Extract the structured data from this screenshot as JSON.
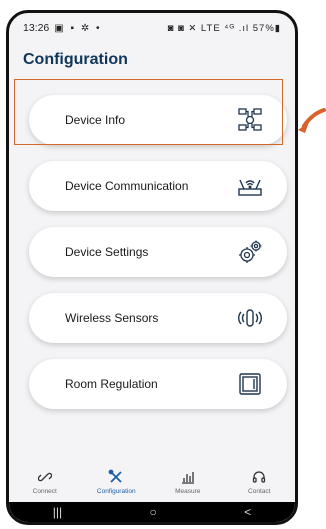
{
  "status": {
    "time": "13:26",
    "left_icons": "▣ ▪ ✲ •",
    "right_icons": "◙ ◙ ✕ LTE ⁴ᴳ .ıl 57%▮"
  },
  "header": {
    "title": "Configuration"
  },
  "cards": [
    {
      "label": "Device Info",
      "icon": "device-network-icon"
    },
    {
      "label": "Device Communication",
      "icon": "router-icon"
    },
    {
      "label": "Device Settings",
      "icon": "gears-icon"
    },
    {
      "label": "Wireless Sensors",
      "icon": "wireless-sensor-icon"
    },
    {
      "label": "Room Regulation",
      "icon": "thermostat-icon"
    }
  ],
  "nav": [
    {
      "label": "Connect",
      "icon": "link-icon"
    },
    {
      "label": "Configuration",
      "icon": "tools-icon",
      "active": true
    },
    {
      "label": "Measure",
      "icon": "bar-chart-icon"
    },
    {
      "label": "Contact",
      "icon": "headset-icon"
    }
  ],
  "system_nav": {
    "recents": "|||",
    "home": "○",
    "back": "<"
  },
  "colors": {
    "title": "#10365a",
    "accent": "#1d5ea8",
    "highlight": "#cf6a2a"
  }
}
